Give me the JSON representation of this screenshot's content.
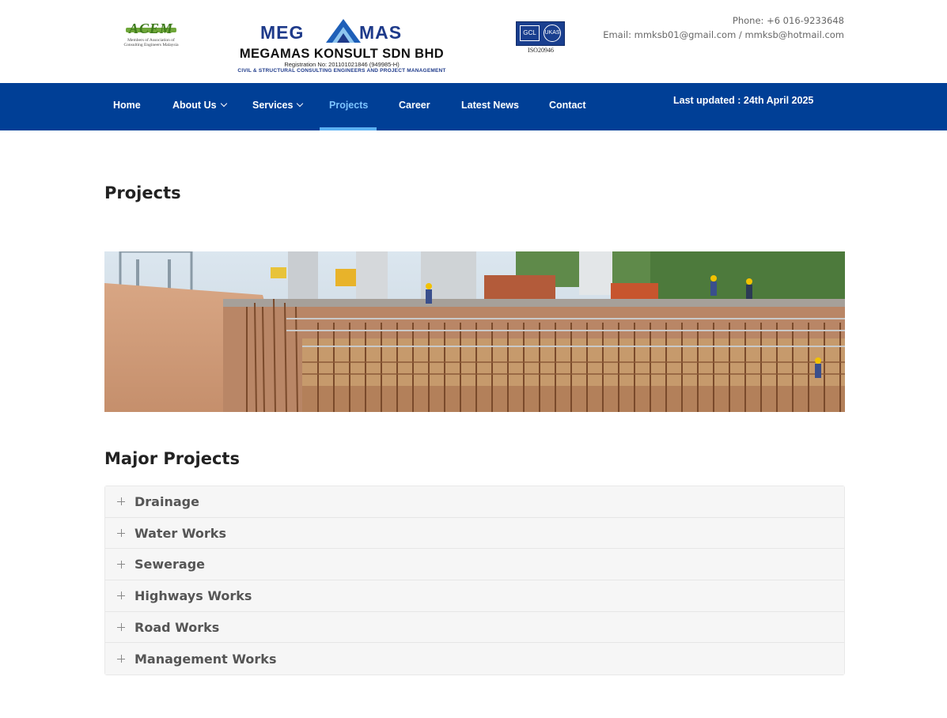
{
  "header": {
    "acem_logo_mark": "ACEM",
    "acem_logo_text": "Members of Association of Consulting Engineers Malaysia",
    "brand": {
      "word_left": "MEG",
      "word_right": "MAS",
      "company_name": "MEGAMAS KONSULT SDN BHD",
      "registration": "Registration No: 201101021846 (949985-H)",
      "tagline": "CIVIL & STRUCTURAL CONSULTING ENGINEERS AND PROJECT MANAGEMENT"
    },
    "iso_badge": {
      "gcl": "GCL",
      "ukas": "UKAS",
      "code": "ISO20946"
    },
    "phone": "Phone: +6 016-9233648",
    "email": "Email: mmksb01@gmail.com / mmksb@hotmail.com"
  },
  "nav": {
    "items": [
      {
        "label": "Home"
      },
      {
        "label": "About Us"
      },
      {
        "label": "Services"
      },
      {
        "label": "Projects"
      },
      {
        "label": "Career"
      },
      {
        "label": "Latest News"
      },
      {
        "label": "Contact"
      }
    ],
    "last_updated": "Last updated : 24th April 2025"
  },
  "main": {
    "page_title": "Projects",
    "section_title": "Major Projects",
    "accordion": [
      {
        "label": "Drainage"
      },
      {
        "label": "Water Works"
      },
      {
        "label": "Sewerage"
      },
      {
        "label": "Highways Works"
      },
      {
        "label": "Road Works"
      },
      {
        "label": "Management Works"
      }
    ]
  },
  "colors": {
    "nav_bg": "#003f96",
    "nav_active": "#7dc4ff",
    "brand_blue": "#1e3a8a"
  }
}
